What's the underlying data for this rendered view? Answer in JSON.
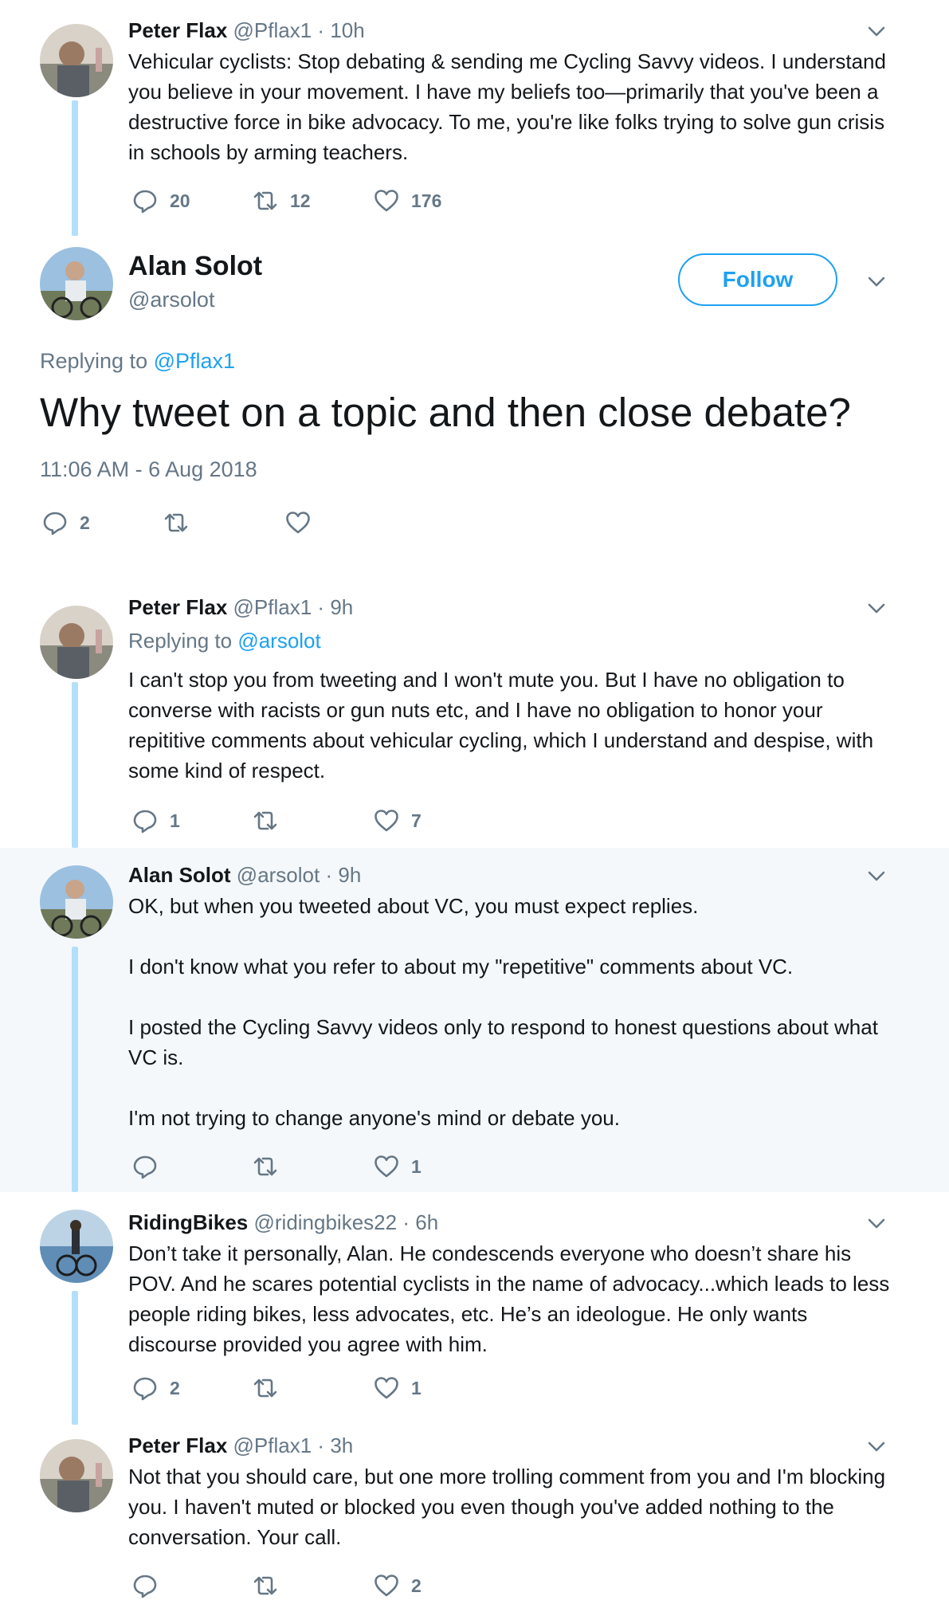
{
  "tweets": [
    {
      "name": "Peter Flax",
      "handle": "@Pflax1",
      "time": "10h",
      "text": "Vehicular cyclists: Stop debating & sending me Cycling Savvy videos. I understand you believe in your movement. I have my beliefs too—primarily that you've been a destructive force in bike advocacy. To me, you're like folks trying to solve gun crisis in schools by arming teachers.",
      "replies": "20",
      "retweets": "12",
      "likes": "176"
    },
    {
      "name": "Peter Flax",
      "handle": "@Pflax1",
      "time": "9h",
      "replying_label": "Replying to ",
      "replying_to": "@arsolot",
      "text": "I can't stop you from tweeting and I won't mute you. But I have no obligation to converse with racists or gun nuts etc, and I have no obligation to honor your repititive comments about vehicular cycling, which I understand and despise, with some kind of respect.",
      "replies": "1",
      "retweets": "",
      "likes": "7"
    },
    {
      "name": "Alan Solot",
      "handle": "@arsolot",
      "time": "9h",
      "text": "OK, but when you tweeted about VC, you must expect replies.\n\nI don't know what you refer to about my \"repetitive\" comments about VC.\n\nI posted the Cycling Savvy videos only to respond to honest questions about what VC is.\n\nI'm not trying to change anyone's mind or debate you.",
      "replies": "",
      "retweets": "",
      "likes": "1"
    },
    {
      "name": "RidingBikes",
      "handle": "@ridingbikes22",
      "time": "6h",
      "text": "Don’t take it personally, Alan. He condescends everyone who doesn’t share his POV. And he scares potential cyclists in the name of advocacy...which leads to less people riding bikes, less advocates, etc. He’s an ideologue. He only wants discourse provided you agree with him.",
      "replies": "2",
      "retweets": "",
      "likes": "1"
    },
    {
      "name": "Peter Flax",
      "handle": "@Pflax1",
      "time": "3h",
      "text": "Not that you should care, but one more trolling comment from you and I'm blocking you. I haven't muted or blocked you even though you've added nothing to the conversation. Your call.",
      "replies": "",
      "retweets": "",
      "likes": "2"
    }
  ],
  "main_tweet": {
    "name": "Alan Solot",
    "handle": "@arsolot",
    "follow_label": "Follow",
    "replying_label": "Replying to ",
    "replying_to": "@Pflax1",
    "text": "Why tweet on a topic and then close debate?",
    "timestamp": "11:06 AM - 6 Aug 2018",
    "replies": "2",
    "retweets": "",
    "likes": ""
  },
  "colors": {
    "accent": "#1da1f2",
    "thread_line": "#b3dffb",
    "secondary_text": "#657786",
    "highlight_bg": "#f5f8fa"
  },
  "icons": [
    "reply-icon",
    "retweet-icon",
    "like-icon",
    "chevron-down-icon"
  ]
}
